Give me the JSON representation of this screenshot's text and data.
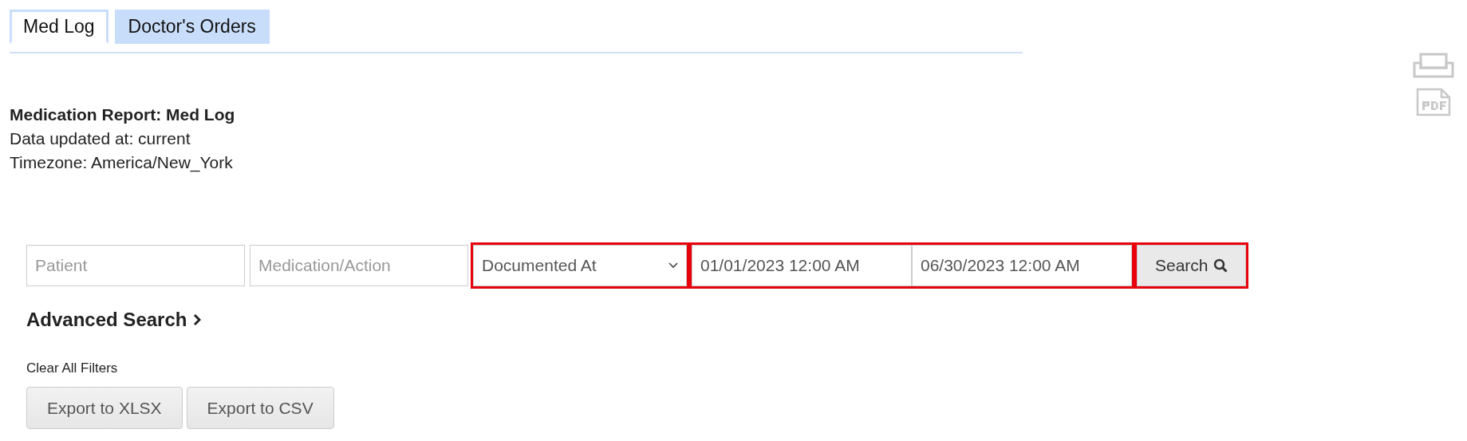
{
  "tabs": [
    {
      "label": "Med Log",
      "selected": true
    },
    {
      "label": "Doctor's Orders",
      "selected": false
    }
  ],
  "report": {
    "title": "Medication Report: Med Log",
    "updated": "Data updated at: current",
    "timezone": "Timezone: America/New_York"
  },
  "filters": [
    {
      "kind": "input",
      "placeholder": "Patient",
      "highlighted": false
    },
    {
      "kind": "input",
      "placeholder": "Medication/Action",
      "highlighted": false
    },
    {
      "kind": "select",
      "value": "Documented At",
      "highlighted": true
    },
    {
      "kind": "range",
      "values": [
        "01/01/2023 12:00 AM",
        "06/30/2023 12:00 AM"
      ],
      "highlighted": true
    },
    {
      "kind": "button",
      "label": "Search",
      "highlighted": true
    }
  ],
  "advanced_search": "Advanced Search",
  "clear_filters": "Clear All Filters",
  "export_buttons": [
    "Export to XLSX",
    "Export to CSV"
  ]
}
